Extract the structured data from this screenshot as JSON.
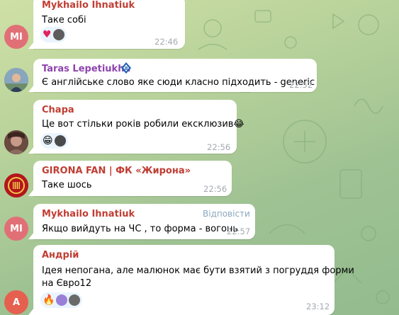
{
  "colors": {
    "chat_bg": "#b6d19a",
    "bubble_bg": "#ffffff",
    "time": "#a3aab0"
  },
  "messages": [
    {
      "sender": "Mykhailo Ihnatiuk",
      "sender_color": "#c03d33",
      "avatar": {
        "initials": "MI",
        "color": "#e17076"
      },
      "lines": [
        "Таке собі"
      ],
      "time": "22:46",
      "reactions": [
        "heart-emoji",
        "user-avatar"
      ]
    },
    {
      "sender": "Taras Lepetiukha",
      "sender_color": "#8e44ad",
      "badge": "dynamo-kyiv-badge-icon",
      "avatar": {
        "type": "photo",
        "color": "#5d7d96"
      },
      "lines": [
        "Є англійське слово яке сюди класно підходить - generic"
      ],
      "time": "22:52"
    },
    {
      "sender": "Chapa",
      "sender_color": "#c03d33",
      "avatar": {
        "type": "photo",
        "color": "#5a3b33"
      },
      "lines": [
        "Це вот стільки років робили ексклюзив😂"
      ],
      "time": "22:56",
      "reactions": [
        "grin-emoji",
        "user-avatar"
      ]
    },
    {
      "sender": "GIRONA FAN | ФК «Жирона»",
      "sender_color": "#c03d33",
      "avatar": {
        "type": "logo",
        "color": "#b4161b"
      },
      "lines": [
        "Таке шось"
      ],
      "time": "22:56"
    },
    {
      "sender": "Mykhailo Ihnatiuk",
      "sender_color": "#c03d33",
      "avatar": {
        "initials": "MI",
        "color": "#e17076"
      },
      "lines": [
        "Якщо вийдуть на ЧС , то форма - вогонь"
      ],
      "meta": "Відповісти",
      "time": "22:57"
    },
    {
      "sender": "Андрій",
      "sender_color": "#c03d33",
      "avatar": {
        "initials": "A",
        "color": "#e5604f"
      },
      "lines": [
        "Ідея непогана, але малюнок має бути взятий з погруддя форми",
        "на Євро12"
      ],
      "time": "23:12",
      "reactions": [
        "fire-emoji",
        "user-avatar",
        "user-avatar"
      ]
    }
  ]
}
